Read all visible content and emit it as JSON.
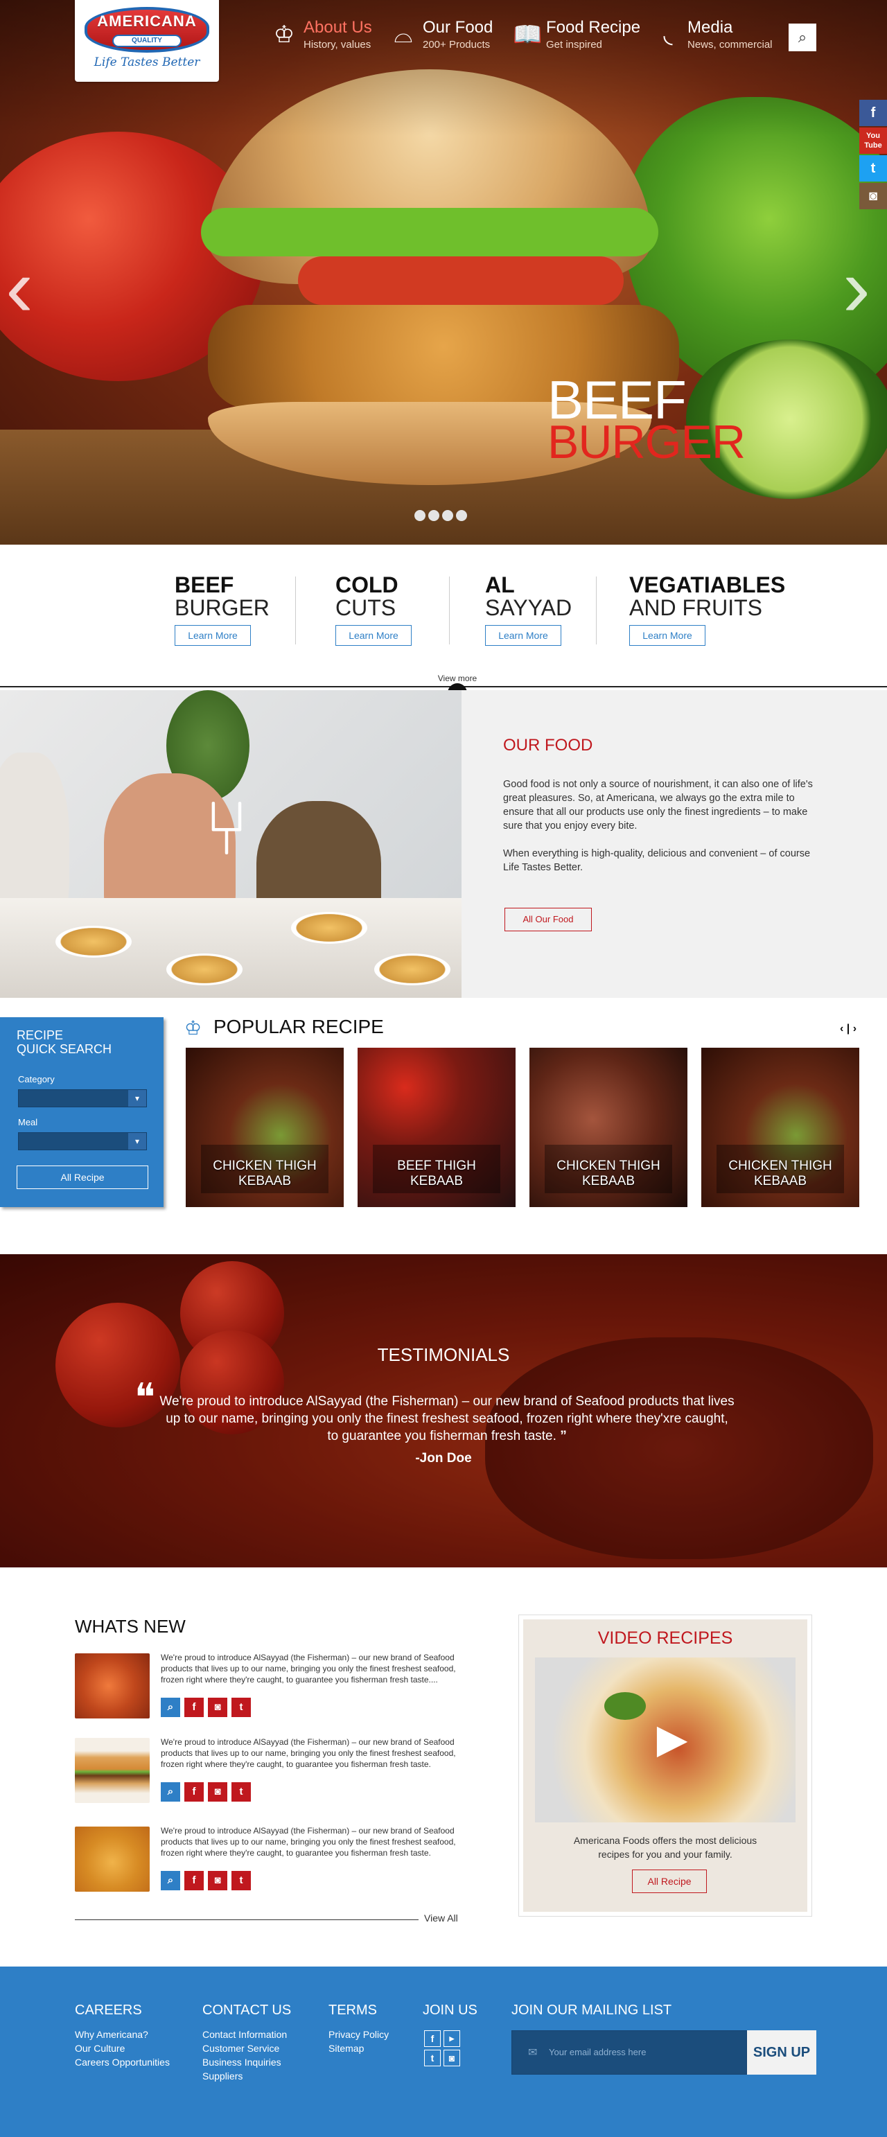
{
  "brand": {
    "logo_text": "AMERICANA",
    "quality": "QUALITY",
    "tagline": "Life Tastes Better"
  },
  "nav": [
    {
      "title": "About Us",
      "subtitle": "History, values",
      "icon": "chef-hat-icon"
    },
    {
      "title": "Our Food",
      "subtitle": "200+ Products",
      "icon": "cloche-icon"
    },
    {
      "title": "Food Recipe",
      "subtitle": "Get inspired",
      "icon": "book-icon"
    },
    {
      "title": "Media",
      "subtitle": "News, commercial",
      "icon": "rss-icon"
    }
  ],
  "social_side": {
    "facebook": "f",
    "youtube": "You Tube",
    "twitter": "t",
    "instagram": "◙"
  },
  "hero": {
    "line1": "BEEF",
    "line2": "BURGER",
    "slides": 4,
    "active_slide": 1
  },
  "categories": [
    {
      "line1": "BEEF",
      "line2": "BURGER",
      "button": "Learn More"
    },
    {
      "line1": "COLD",
      "line2": "CUTS",
      "button": "Learn More"
    },
    {
      "line1": "AL",
      "line2": "SAYYAD",
      "button": "Learn More"
    },
    {
      "line1": "VEGATIABLES",
      "line2": "AND FRUITS",
      "button": "Learn More"
    }
  ],
  "view_more": "View more",
  "our_food": {
    "title": "OUR FOOD",
    "p1": "Good food is not only a source of nourishment, it can also one of life's great pleasures. So, at Americana, we always go the extra mile to ensure that all our products use only the finest ingredients – to make sure that you enjoy every bite.",
    "p2": "When everything is high-quality, delicious and convenient – of course Life Tastes Better.",
    "button": "All Our Food"
  },
  "quick_search": {
    "title1": "RECIPE",
    "title2": "QUICK SEARCH",
    "category_label": "Category",
    "meal_label": "Meal",
    "category_value": "",
    "meal_value": "",
    "button": "All Recipe"
  },
  "popular": {
    "title": "POPULAR RECIPE",
    "nav": "‹ | ›",
    "items": [
      {
        "line1": "CHICKEN THIGH",
        "line2": "KEBAAB"
      },
      {
        "line1": "BEEF THIGH",
        "line2": "KEBAAB"
      },
      {
        "line1": "CHICKEN THIGH",
        "line2": "KEBAAB"
      },
      {
        "line1": "CHICKEN THIGH",
        "line2": "KEBAAB"
      }
    ]
  },
  "testimonials": {
    "title": "TESTIMONIALS",
    "text": "We're proud to introduce AlSayyad (the Fisherman) – our new brand of Seafood products that lives up to our name, bringing you only the finest freshest seafood, frozen right where they'xre caught, to guarantee you fisherman fresh taste.",
    "author": "-Jon Doe"
  },
  "whats_new": {
    "title": "WHATS NEW",
    "items": [
      {
        "text": "We're proud to introduce AlSayyad (the Fisherman) – our new brand of Seafood products that lives up to our name, bringing you only the finest freshest seafood, frozen right where they're caught, to guarantee you fisherman fresh taste...."
      },
      {
        "text": "We're proud to introduce AlSayyad (the Fisherman) – our new brand of Seafood products that lives up to our name, bringing you only the finest freshest seafood, frozen right where they're caught, to guarantee you fisherman fresh taste."
      },
      {
        "text": "We're proud to introduce AlSayyad (the Fisherman) – our new brand of Seafood products that lives up to our name, bringing you only the finest freshest seafood, frozen right where they're caught, to guarantee you fisherman fresh taste."
      }
    ],
    "view_all": "View All"
  },
  "video": {
    "title": "VIDEO RECIPES",
    "text": "Americana Foods offers the most delicious recipes for you and your family.",
    "button": "All Recipe"
  },
  "footer": {
    "careers": {
      "title": "CAREERS",
      "links": [
        "Why Americana?",
        "Our Culture",
        "Careers Opportunities"
      ]
    },
    "contact": {
      "title": "CONTACT US",
      "links": [
        "Contact Information",
        "Customer Service",
        "Business Inquiries",
        "Suppliers"
      ]
    },
    "terms": {
      "title": "TERMS",
      "links": [
        "Privacy Policy",
        "Sitemap"
      ]
    },
    "join": {
      "title": "JOIN US"
    },
    "mailing": {
      "title": "JOIN OUR MAILING LIST",
      "placeholder": "Your email address here",
      "button": "SIGN UP"
    }
  },
  "colors": {
    "brand_blue": "#2e7fc6",
    "brand_red": "#c0181e",
    "active_nav": "#ff7262"
  }
}
